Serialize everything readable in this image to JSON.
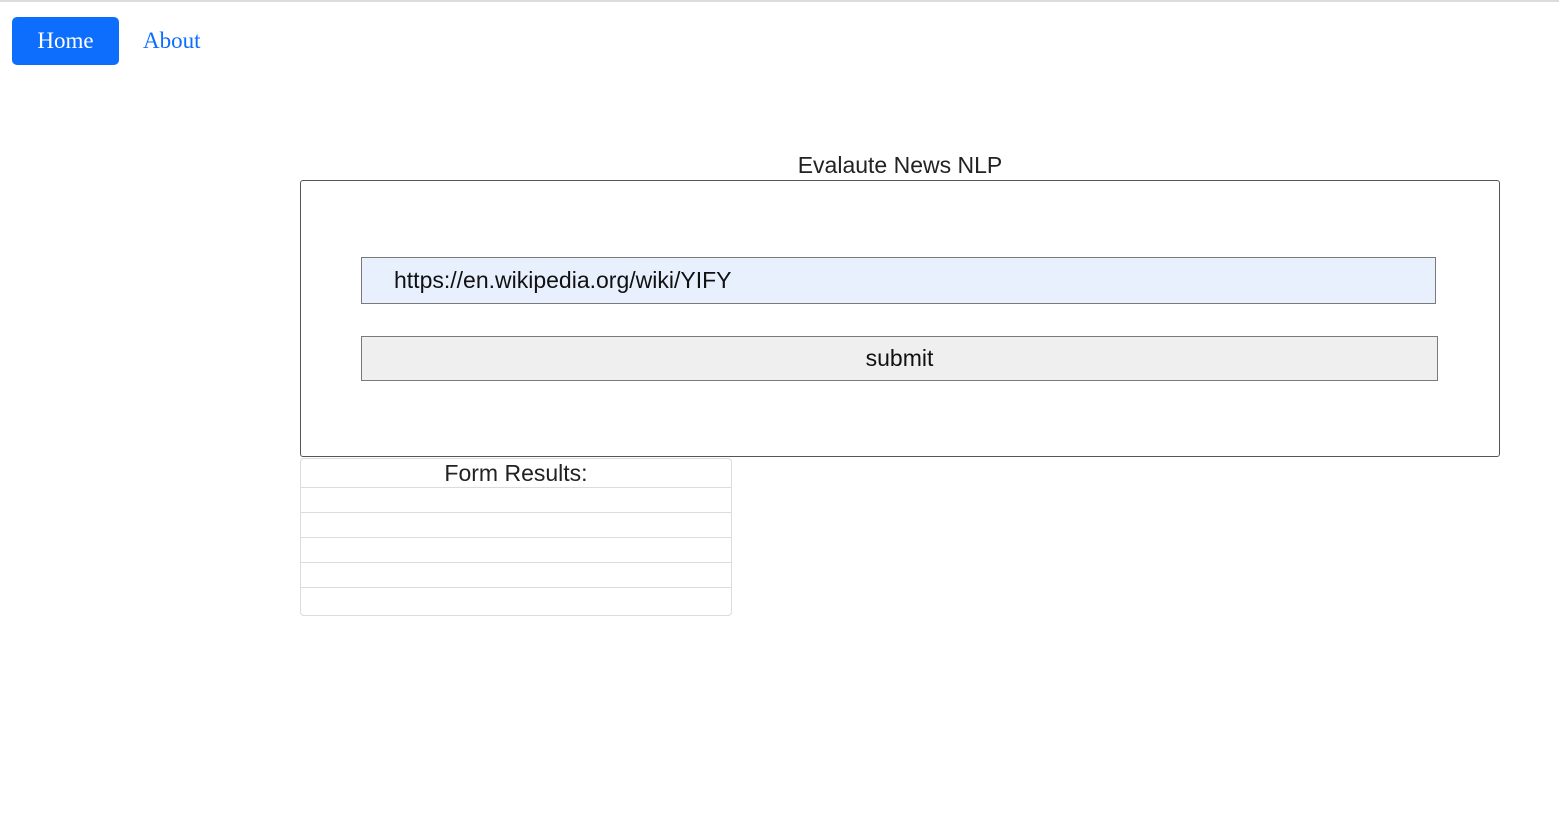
{
  "nav": {
    "home_label": "Home",
    "about_label": "About"
  },
  "form": {
    "title": "Evalaute News NLP",
    "url_value": "https://en.wikipedia.org/wiki/YIFY",
    "submit_label": "submit"
  },
  "results": {
    "title": "Form Results:",
    "rows": [
      "",
      "",
      "",
      "",
      ""
    ]
  },
  "colors": {
    "primary": "#0d6efd",
    "input_autofill_bg": "#e8f0fe",
    "button_bg": "#efefef"
  }
}
